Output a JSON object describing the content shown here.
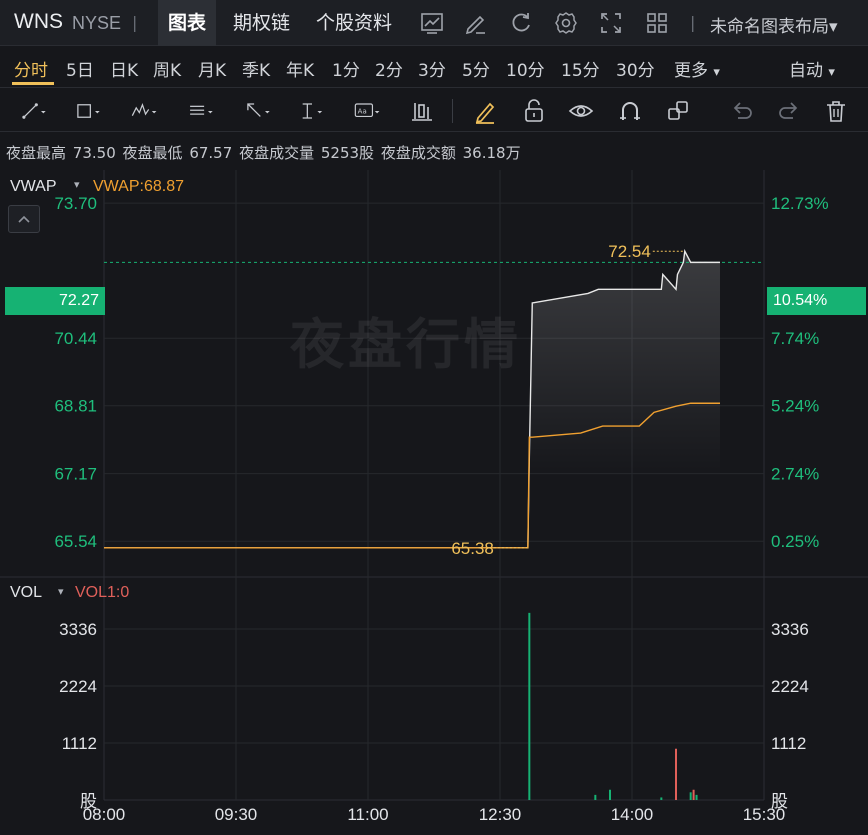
{
  "header": {
    "ticker": "WNS",
    "exchange": "NYSE",
    "separator": "|",
    "tabs": [
      {
        "label": "图表",
        "active": true
      },
      {
        "label": "期权链",
        "active": false
      },
      {
        "label": "个股资料",
        "active": false
      }
    ],
    "icons": [
      "chart-indicator-icon",
      "edit-icon",
      "refresh-icon",
      "settings-icon",
      "fullscreen-icon",
      "grid-layout-icon"
    ],
    "layout_label": "未命名图表布局",
    "layout_caret": "▾"
  },
  "periods": {
    "items": [
      "分时",
      "5日",
      "日K",
      "周K",
      "月K",
      "季K",
      "年K",
      "1分",
      "2分",
      "3分",
      "5分",
      "10分",
      "15分",
      "30分",
      "更多"
    ],
    "active": "分时",
    "more_caret": "▾",
    "auto_label": "自动",
    "auto_caret": "▾"
  },
  "toolbar": {
    "tools": [
      "trendline-tool-icon",
      "rectangle-tool-icon",
      "pattern-tool-icon",
      "text-list-tool-icon",
      "arrow-tool-icon",
      "measure-tool-icon",
      "annotation-tool-icon",
      "candle-tool-icon",
      "brush-icon",
      "lock-icon",
      "eye-icon",
      "magnet-icon",
      "layers-icon",
      "undo-icon",
      "redo-icon",
      "trash-icon"
    ]
  },
  "stats": {
    "high_label": "夜盘最高",
    "high_value": "73.50",
    "low_label": "夜盘最低",
    "low_value": "67.57",
    "volume_label": "夜盘成交量",
    "volume_value": "5253股",
    "amount_label": "夜盘成交额",
    "amount_value": "36.18万"
  },
  "main_panel": {
    "indicator": "VWAP",
    "indicator_caret": "▾",
    "indicator_value": "VWAP:68.87",
    "watermark": "夜盘行情",
    "current_price": "72.27",
    "current_pct": "10.54%",
    "price_marker_high": "72.54",
    "price_marker_low": "65.38"
  },
  "volume_panel": {
    "indicator": "VOL",
    "indicator_caret": "▾",
    "indicator_value": "VOL1:0",
    "unit_left": "股",
    "unit_right": "股"
  },
  "colors": {
    "up": "#16b273",
    "down": "#e0605a",
    "accent": "#f0c05a",
    "vwap": "#f0a030"
  },
  "chart_data": [
    {
      "type": "line",
      "series": [
        {
          "name": "",
          "color": "#e8e8e8",
          "x": [
            "08:00",
            "12:49",
            "12:50",
            "12:52",
            "13:30",
            "13:37",
            "14:20",
            "14:21",
            "14:30",
            "14:31",
            "14:35",
            "14:36",
            "14:40",
            "14:46",
            "15:00"
          ],
          "y": [
            65.38,
            65.38,
            67.57,
            71.29,
            71.52,
            71.62,
            71.62,
            71.98,
            71.62,
            71.98,
            72.27,
            72.54,
            72.27,
            72.27,
            72.27
          ]
        },
        {
          "name": "VWAP",
          "color": "#f0a030",
          "x": [
            "08:00",
            "12:49",
            "12:50",
            "12:52",
            "13:25",
            "13:40",
            "14:05",
            "14:15",
            "14:30",
            "14:40",
            "15:00"
          ],
          "y": [
            65.38,
            65.38,
            68.05,
            68.05,
            68.15,
            68.32,
            68.32,
            68.65,
            68.8,
            68.87,
            68.87
          ]
        }
      ],
      "yticks_left": [
        "73.70",
        "70.44",
        "68.81",
        "67.17",
        "65.54"
      ],
      "yticks_right": [
        "12.73%",
        "7.74%",
        "5.24%",
        "2.74%",
        "0.25%"
      ],
      "ylim": [
        64.7,
        74.5
      ]
    },
    {
      "type": "bar",
      "series": [
        {
          "name": "VOL",
          "x": [
            "12:50",
            "13:35",
            "13:45",
            "14:20",
            "14:30",
            "14:40",
            "14:42",
            "14:44"
          ],
          "values": [
            3650,
            100,
            200,
            50,
            1000,
            150,
            200,
            100
          ],
          "colors": [
            "#16b273",
            "#16b273",
            "#16b273",
            "#16b273",
            "#e0605a",
            "#16b273",
            "#e0605a",
            "#16b273"
          ]
        }
      ],
      "yticks_left": [
        "3336",
        "2224",
        "1112"
      ],
      "yticks_right": [
        "3336",
        "2224",
        "1112"
      ],
      "ylim": [
        0,
        4330
      ]
    }
  ],
  "xaxis": {
    "ticks": [
      "08:00",
      "09:30",
      "11:00",
      "12:30",
      "14:00",
      "15:30"
    ],
    "min_minutes": 480,
    "max_minutes": 930
  }
}
